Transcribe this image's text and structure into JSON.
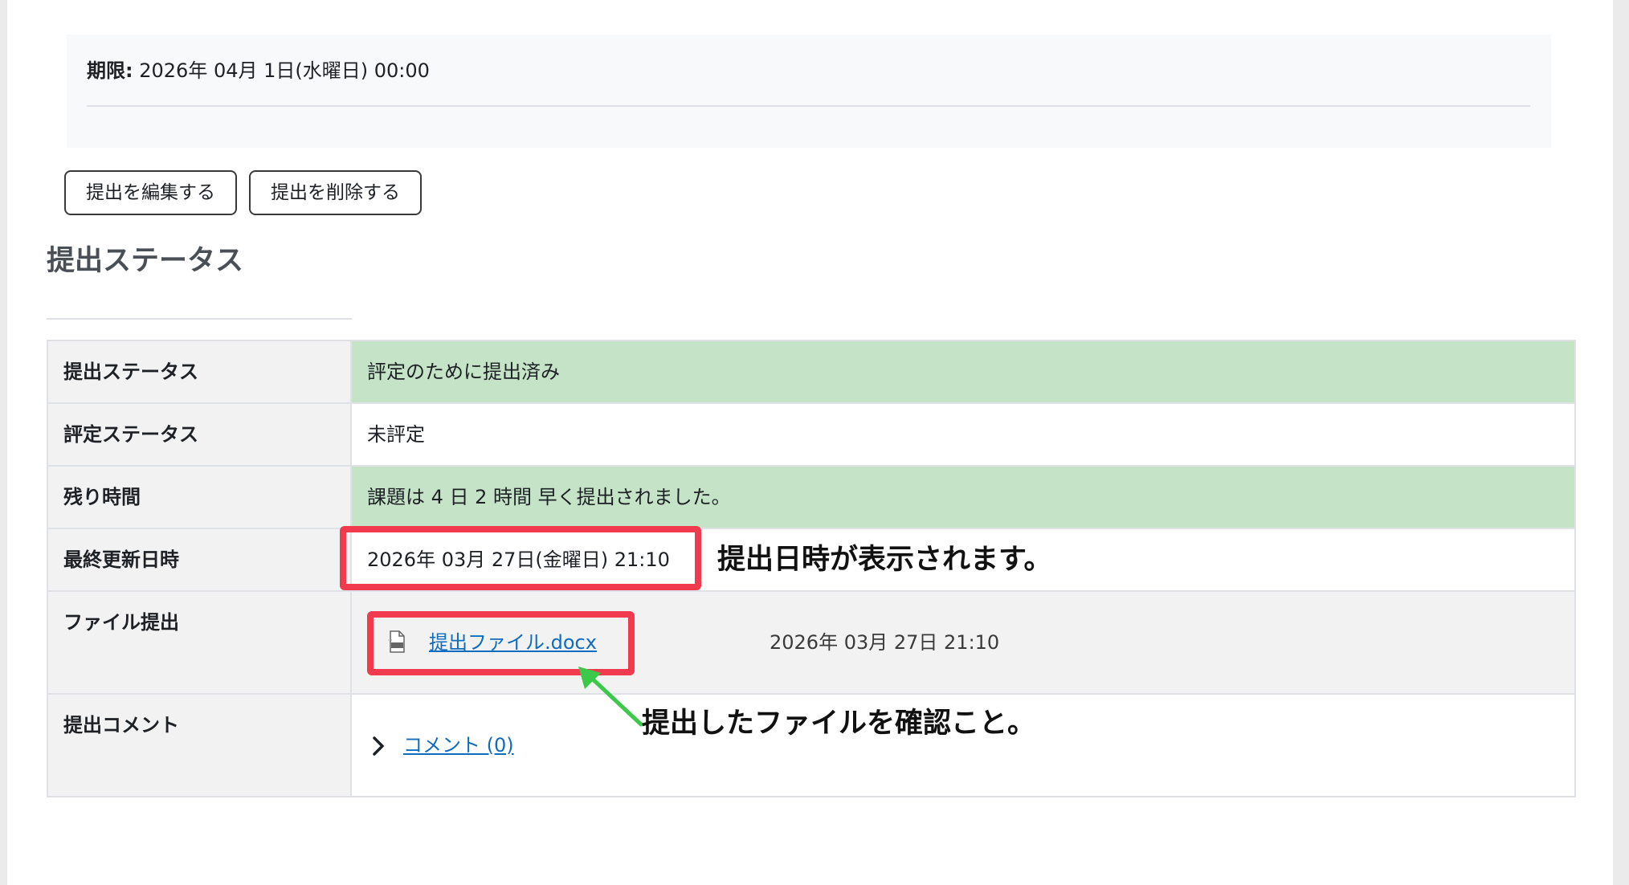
{
  "due": {
    "label": "期限:",
    "value": "2026年 04月 1日(水曜日) 00:00"
  },
  "buttons": {
    "edit_label": "提出を編集する",
    "delete_label": "提出を削除する"
  },
  "section": {
    "title": "提出ステータス"
  },
  "table": {
    "rows": [
      {
        "label": "提出ステータス",
        "value": "評定のために提出済み"
      },
      {
        "label": "評定ステータス",
        "value": "未評定"
      },
      {
        "label": "残り時間",
        "value": "課題は 4 日 2 時間 早く提出されました。"
      },
      {
        "label": "最終更新日時",
        "value": "2026年 03月 27日(金曜日) 21:10"
      },
      {
        "label": "ファイル提出",
        "file_name": "提出ファイル.docx",
        "file_date": "2026年 03月 27日 21:10"
      },
      {
        "label": "提出コメント",
        "comment_link": "コメント (0)"
      }
    ]
  },
  "annotations": {
    "date_note": "提出日時が表示されます。",
    "file_note": "提出したファイルを確認こと。"
  },
  "icons": {
    "file": "docx-file-icon",
    "chevron": "chevron-right-icon",
    "arrow": "green-arrow"
  },
  "colors": {
    "highlight": "#f03a4e",
    "arrow": "#3cc94a",
    "status_green": "#c5e3c6",
    "link": "#0f6cbf"
  }
}
